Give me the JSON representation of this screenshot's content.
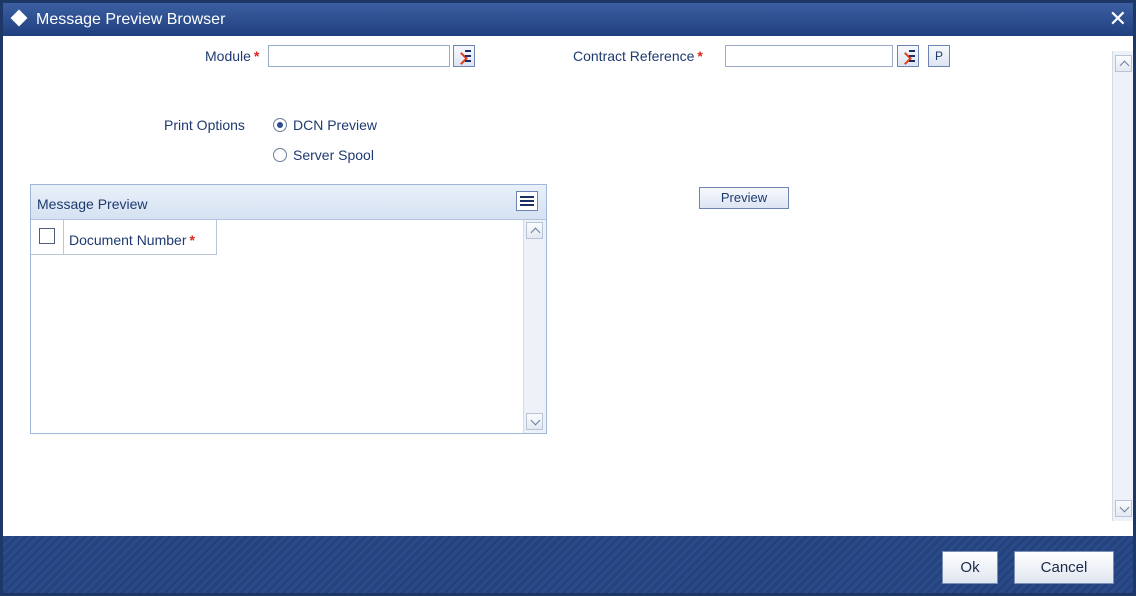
{
  "window": {
    "title": "Message Preview Browser",
    "close_glyph": "✕"
  },
  "form": {
    "module_label": "Module",
    "module_value": "",
    "contract_reference_label": "Contract Reference",
    "contract_reference_value": "",
    "required_mark": "*",
    "p_button_label": "P",
    "print_options_label": "Print Options",
    "print_options": [
      {
        "label": "DCN Preview",
        "selected": true
      },
      {
        "label": "Server Spool",
        "selected": false
      }
    ]
  },
  "message_preview": {
    "title": "Message Preview",
    "columns": [
      {
        "label": "Document Number",
        "required": true
      }
    ],
    "rows": []
  },
  "preview_button_label": "Preview",
  "footer": {
    "ok_label": "Ok",
    "cancel_label": "Cancel"
  },
  "colors": {
    "title_bar": "#2b4c8c",
    "footer": "#27457f",
    "label_text": "#1f3a70",
    "required": "#e0241b"
  }
}
